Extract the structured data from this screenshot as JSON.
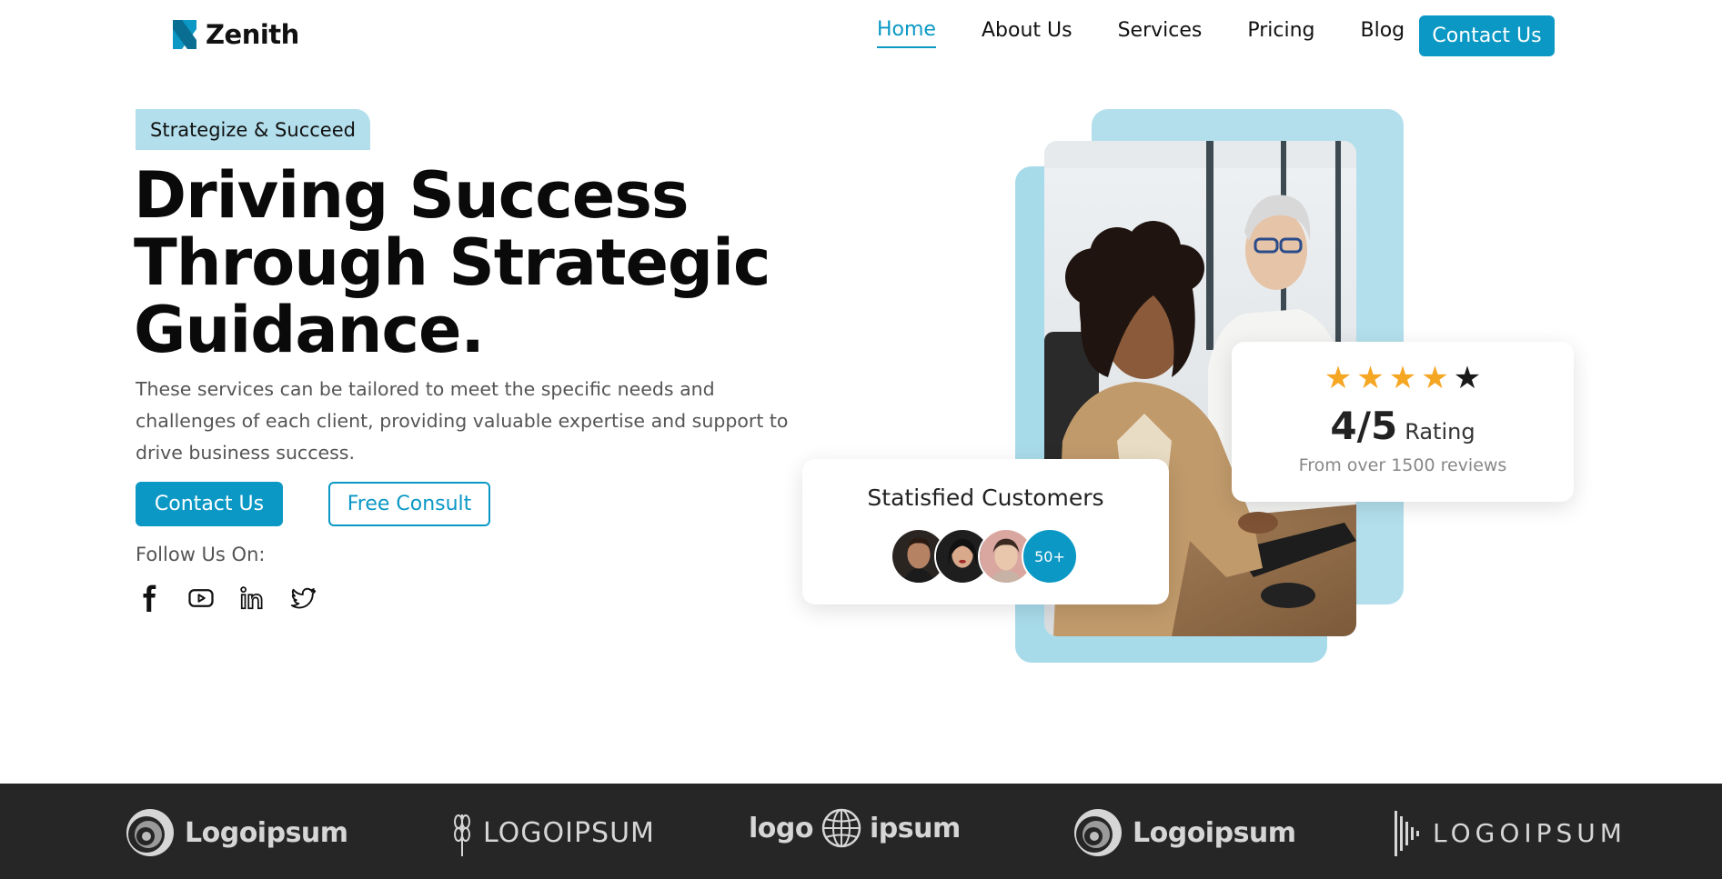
{
  "brand": {
    "name": "Zenith",
    "accent": "#0b98c5"
  },
  "nav": {
    "items": [
      {
        "label": "Home",
        "active": true
      },
      {
        "label": "About Us",
        "active": false
      },
      {
        "label": "Services",
        "active": false
      },
      {
        "label": "Pricing",
        "active": false
      },
      {
        "label": "Blog",
        "active": false
      }
    ],
    "cta": "Contact Us"
  },
  "hero": {
    "badge": "Strategize & Succeed",
    "headline_lines": [
      "Driving Success",
      "Through Strategic",
      "Guidance."
    ],
    "lead": "These services can be tailored to meet the specific needs and challenges of each client, providing valuable expertise and support to drive business success.",
    "primary_button": "Contact Us",
    "secondary_button": "Free Consult",
    "follow_label": "Follow Us On:",
    "socials": [
      "facebook-icon",
      "youtube-icon",
      "linkedin-icon",
      "twitter-icon"
    ]
  },
  "rating_card": {
    "stars_filled": 4,
    "stars_total": 5,
    "value": "4/5",
    "label": "Rating",
    "subtitle": "From over 1500 reviews",
    "star_color": "#f5a623"
  },
  "customers_card": {
    "title": "Statisfied Customers",
    "more": "50+"
  },
  "logo_strip": {
    "background": "#262626",
    "logos": [
      "Logoipsum",
      "LOGOIPSUM",
      "logo",
      "ipsum",
      "Logoipsum",
      "LOGOIPSUM"
    ]
  }
}
